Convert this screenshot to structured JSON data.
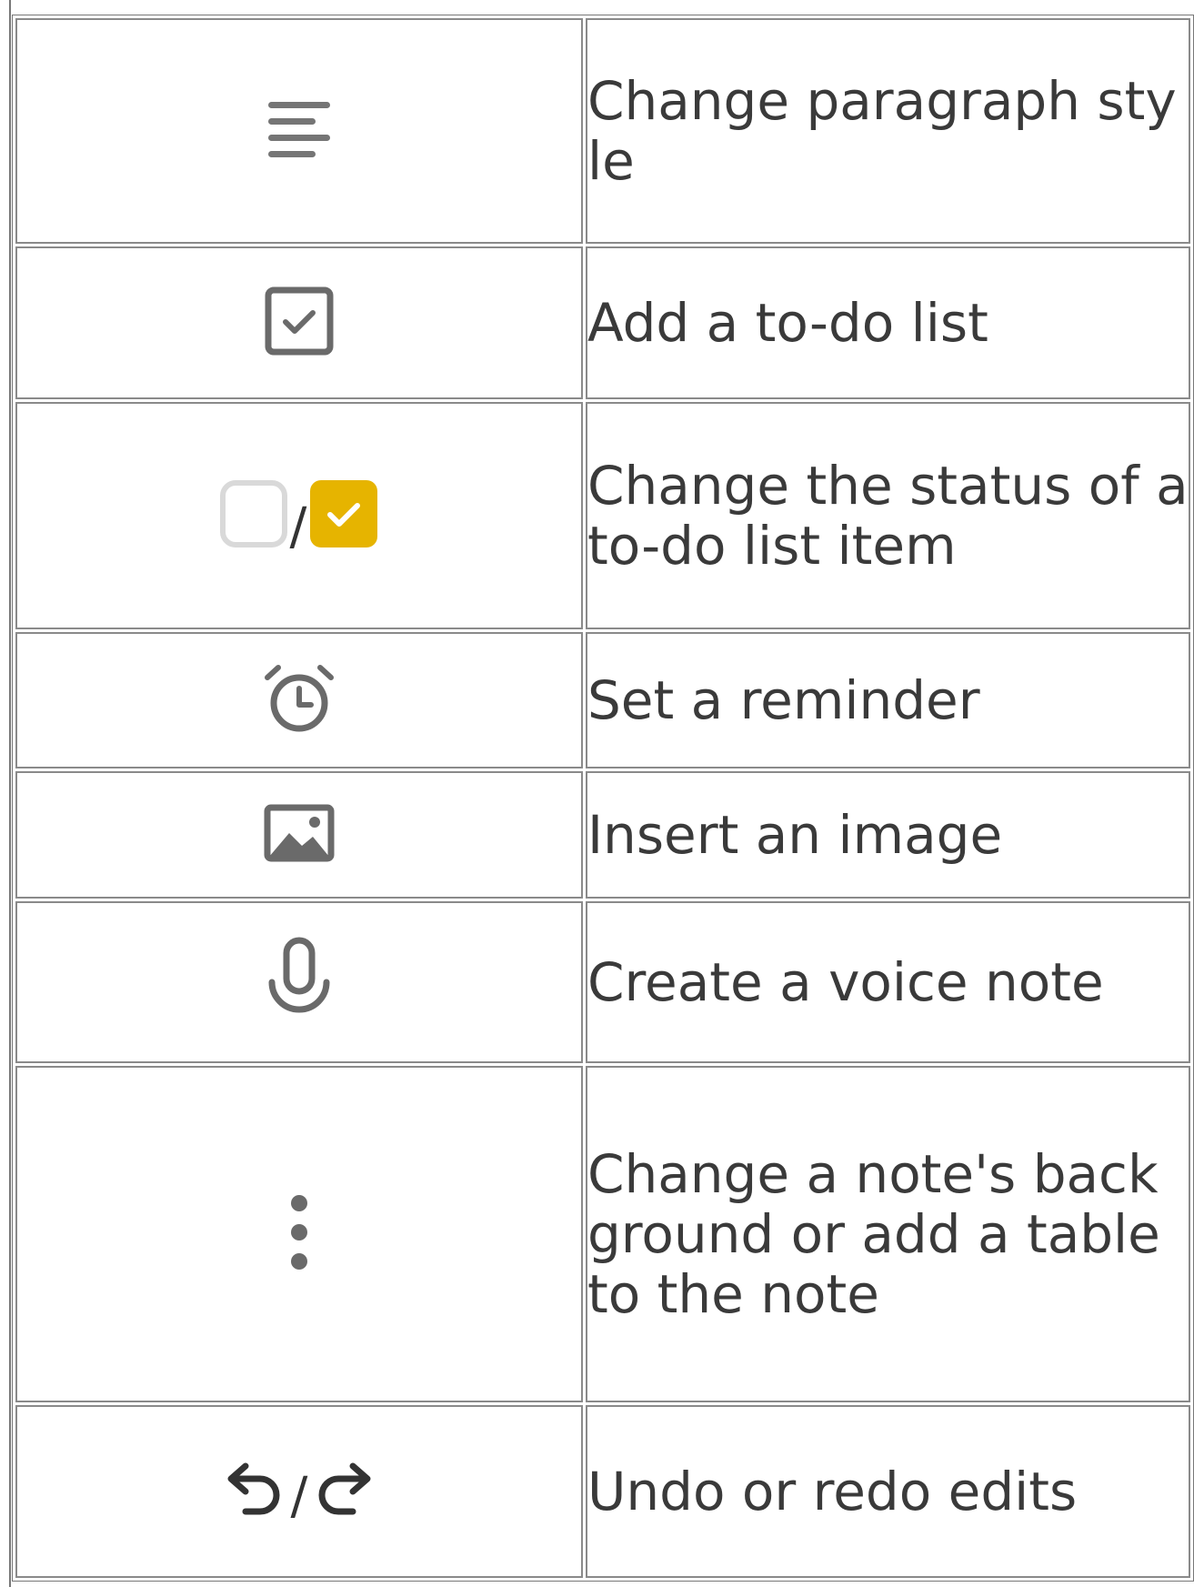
{
  "rows": [
    {
      "icon": "paragraph-style-icon",
      "text": "Change paragraph style"
    },
    {
      "icon": "todo-checkbox-icon",
      "text": "Add a to-do list"
    },
    {
      "icon": "todo-status-icons",
      "separator": "/",
      "text": "Change the status of a to-do list item"
    },
    {
      "icon": "alarm-clock-icon",
      "text": "Set a reminder"
    },
    {
      "icon": "image-icon",
      "text": "Insert an image"
    },
    {
      "icon": "microphone-icon",
      "text": "Create a voice note"
    },
    {
      "icon": "more-vertical-icon",
      "text": "Change a note's background or add a table to the note"
    },
    {
      "icon": "undo-redo-icons",
      "separator": "/",
      "text": "Undo or redo edits"
    }
  ],
  "colors": {
    "icon_gray": "#757575",
    "checked_yellow": "#E6B400",
    "unchecked_border": "#D9D9D9",
    "undo_redo": "#333333",
    "text": "#3a3a3a"
  }
}
